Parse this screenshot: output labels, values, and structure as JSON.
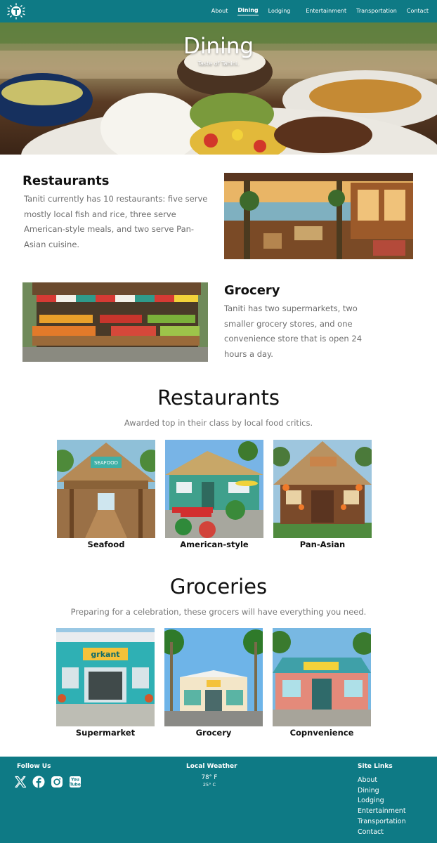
{
  "nav": {
    "items": [
      {
        "label": "About",
        "active": false
      },
      {
        "label": "Dining",
        "active": true
      },
      {
        "label": "Lodging",
        "active": false
      },
      {
        "label": "Entertainment",
        "active": false
      },
      {
        "label": "Transportation",
        "active": false
      },
      {
        "label": "Contact",
        "active": false
      }
    ]
  },
  "hero": {
    "title": "Dining",
    "subtitle": "Taste of Tahini."
  },
  "intro": {
    "restaurants": {
      "title": "Restaurants",
      "text": "Taniti currently has 10 restaurants: five serve mostly local fish and rice, three serve American-style meals, and two serve Pan-Asian cuisine."
    },
    "grocery": {
      "title": "Grocery",
      "text": "Taniti has two supermarkets, two smaller grocery stores, and one convenience store that is open 24 hours a day."
    }
  },
  "restaurants_section": {
    "title": "Restaurants",
    "subtitle": "Awarded top in their class by local food critics.",
    "cards": [
      {
        "label": "Seafood",
        "sign": "SEAFOOD"
      },
      {
        "label": "American-style",
        "sign": ""
      },
      {
        "label": "Pan-Asian",
        "sign": ""
      }
    ]
  },
  "groceries_section": {
    "title": "Groceries",
    "subtitle": "Preparing for a celebration, these grocers will have everything you need.",
    "cards": [
      {
        "label": "Supermarket",
        "sign": "grkant"
      },
      {
        "label": "Grocery",
        "sign": ""
      },
      {
        "label": "Copnvenience",
        "sign": ""
      }
    ]
  },
  "footer": {
    "follow_title": "Follow Us",
    "social": [
      "x-icon",
      "facebook-icon",
      "instagram-icon",
      "youtube-icon"
    ],
    "youtube_text": "You Tube",
    "weather_title": "Local Weather",
    "temp_f": "78° F",
    "temp_c": "25° C",
    "links_title": "Site Links",
    "links": [
      "About",
      "Dining",
      "Lodging",
      "Entertainment",
      "Transportation",
      "Contact"
    ]
  },
  "colors": {
    "brand": "#0e7a85",
    "text_muted": "#6d6d6d",
    "white": "#ffffff"
  }
}
